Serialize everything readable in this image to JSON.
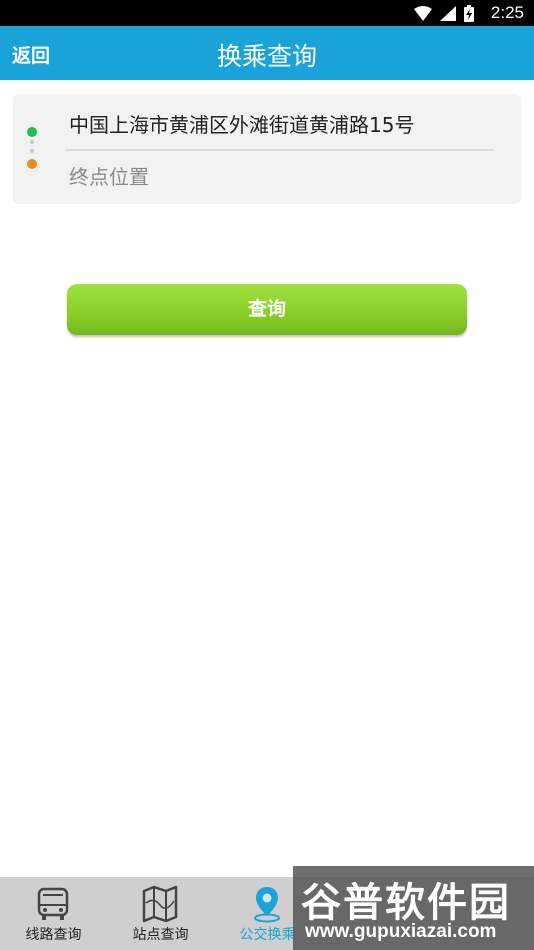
{
  "status_bar": {
    "time": "2:25"
  },
  "header": {
    "back_label": "返回",
    "title": "换乘查询"
  },
  "route": {
    "start_value": "中国上海市黄浦区外滩街道黄浦路15号",
    "end_placeholder": "终点位置"
  },
  "query_button": {
    "label": "查询"
  },
  "bottom_nav": {
    "items": [
      {
        "label": "线路查询",
        "icon": "bus-icon"
      },
      {
        "label": "站点查询",
        "icon": "map-icon"
      },
      {
        "label": "公交换乘",
        "icon": "location-pin-icon",
        "active": true
      }
    ]
  },
  "watermark": {
    "name": "谷普软件园",
    "url": "www.gupuxiazai.com"
  },
  "colors": {
    "header_bg": "#1aa3d8",
    "button_green": "#8ad02a",
    "start_dot": "#22c04a",
    "end_dot": "#f08a1c",
    "nav_bg": "#cfcfcf"
  }
}
